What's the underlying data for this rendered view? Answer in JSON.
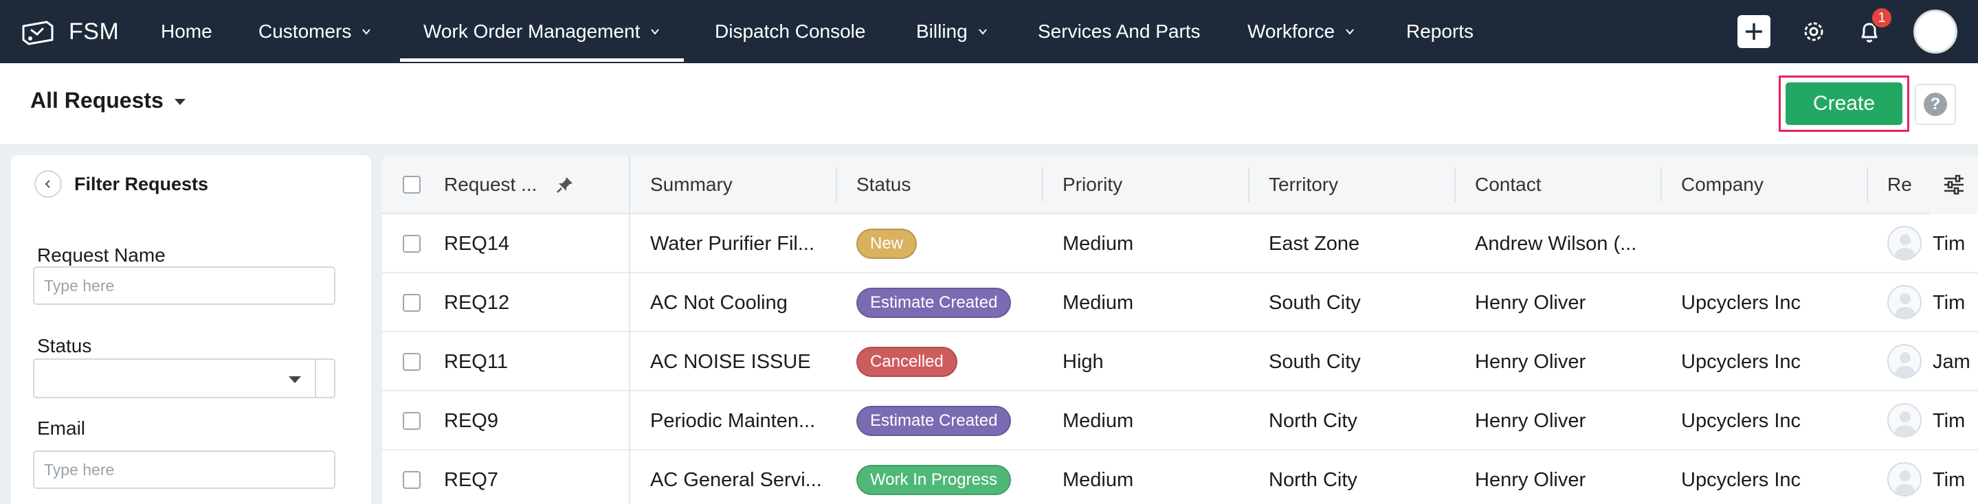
{
  "app": {
    "name": "FSM"
  },
  "nav": {
    "items": [
      {
        "label": "Home",
        "has_menu": false
      },
      {
        "label": "Customers",
        "has_menu": true
      },
      {
        "label": "Work Order Management",
        "has_menu": true,
        "active": true
      },
      {
        "label": "Dispatch Console",
        "has_menu": false
      },
      {
        "label": "Billing",
        "has_menu": true
      },
      {
        "label": "Services And Parts",
        "has_menu": false
      },
      {
        "label": "Workforce",
        "has_menu": true
      },
      {
        "label": "Reports",
        "has_menu": false
      }
    ],
    "notification_count": "1"
  },
  "header": {
    "view_title": "All Requests",
    "create_label": "Create",
    "help_label": "?"
  },
  "filter": {
    "title": "Filter Requests",
    "fields": [
      {
        "label": "Request Name",
        "placeholder": "Type here"
      },
      {
        "label": "Status",
        "value": ""
      },
      {
        "label": "Email",
        "placeholder": "Type here"
      }
    ]
  },
  "table": {
    "columns": [
      "Request ...",
      "Summary",
      "Status",
      "Priority",
      "Territory",
      "Contact",
      "Company",
      "Re"
    ],
    "rows": [
      {
        "id": "REQ14",
        "summary": "Water Purifier Fil...",
        "status": "New",
        "status_color": "#d9b25f",
        "priority": "Medium",
        "territory": "East Zone",
        "contact": "Andrew Wilson (...",
        "company": "",
        "assignee": "Tim"
      },
      {
        "id": "REQ12",
        "summary": "AC Not Cooling",
        "status": "Estimate Created",
        "status_color": "#7a6bb3",
        "priority": "Medium",
        "territory": "South City",
        "contact": "Henry Oliver",
        "company": "Upcyclers Inc",
        "assignee": "Tim"
      },
      {
        "id": "REQ11",
        "summary": "AC NOISE ISSUE",
        "status": "Cancelled",
        "status_color": "#cd5c5c",
        "priority": "High",
        "territory": "South City",
        "contact": "Henry Oliver",
        "company": "Upcyclers Inc",
        "assignee": "Jam"
      },
      {
        "id": "REQ9",
        "summary": "Periodic Mainten...",
        "status": "Estimate Created",
        "status_color": "#7a6bb3",
        "priority": "Medium",
        "territory": "North City",
        "contact": "Henry Oliver",
        "company": "Upcyclers Inc",
        "assignee": "Tim"
      },
      {
        "id": "REQ7",
        "summary": "AC General Servi...",
        "status": "Work In Progress",
        "status_color": "#4fb878",
        "priority": "Medium",
        "territory": "North City",
        "contact": "Henry Oliver",
        "company": "Upcyclers Inc",
        "assignee": "Tim"
      }
    ]
  },
  "colors": {
    "nav_bg": "#1e2a3a",
    "create_green": "#22a863",
    "highlight": "#e8245a",
    "badge_red": "#e5443f"
  },
  "icons": [
    "fsm-logo-icon",
    "chevron-down-icon",
    "plus-icon",
    "gear-icon",
    "bell-icon",
    "avatar",
    "caret-down-icon",
    "help-icon",
    "back-arrow-icon",
    "pin-icon",
    "column-settings-icon"
  ]
}
